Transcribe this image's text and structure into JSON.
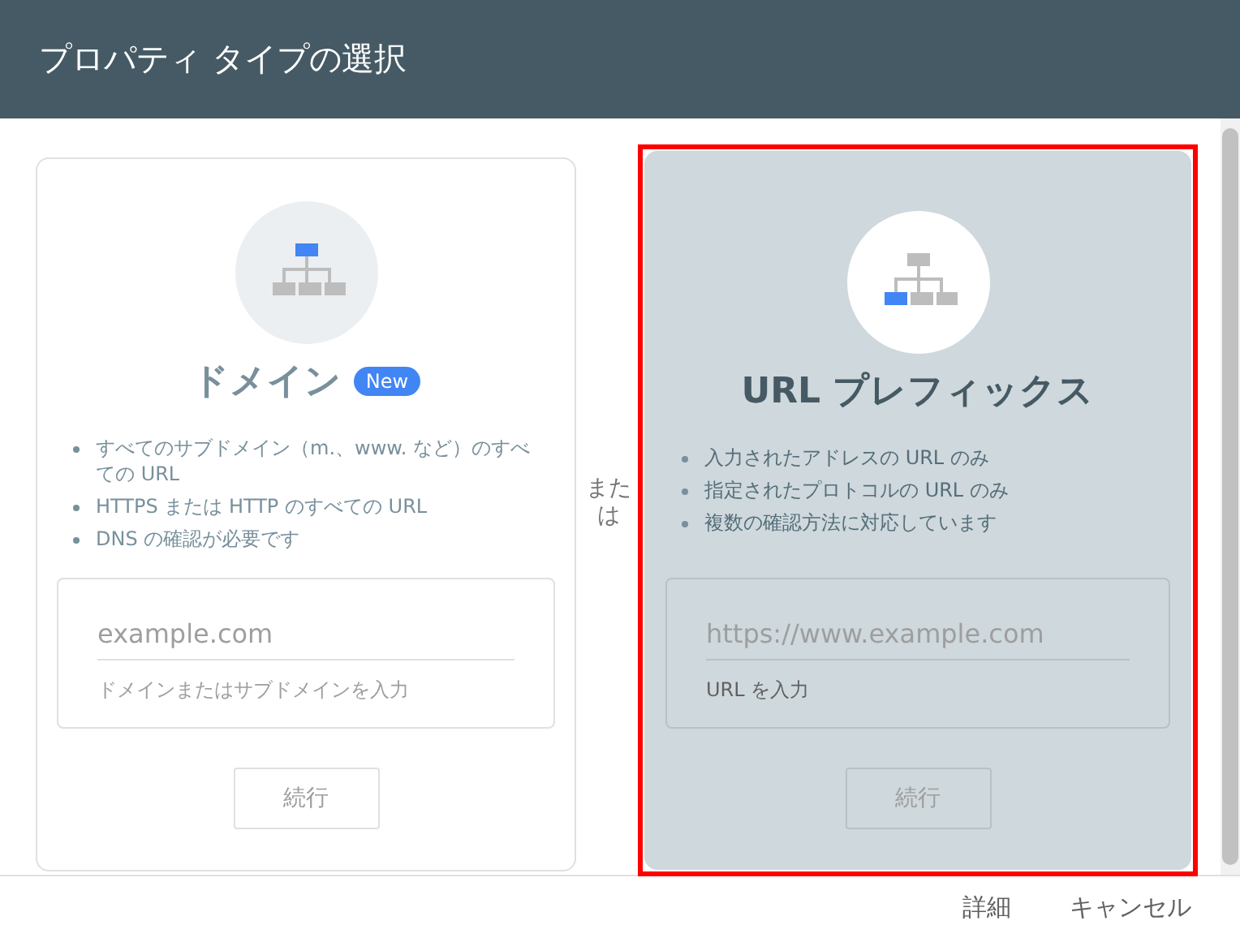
{
  "window": {
    "title": "プロパティ タイプの選択"
  },
  "separator": "または",
  "cards": [
    {
      "title": "ドメイン",
      "badge": "New",
      "selected": false,
      "bullets": [
        "すべてのサブドメイン（m.、www. など）のすべての URL",
        "HTTPS または HTTP のすべての URL",
        "DNS の確認が必要です"
      ],
      "field": {
        "placeholder": "example.com",
        "helper": "ドメインまたはサブドメインを入力"
      },
      "button": {
        "label": "続行",
        "disabled": true
      }
    },
    {
      "title": "URL プレフィックス",
      "selected": true,
      "bullets": [
        "入力されたアドレスの URL のみ",
        "指定されたプロトコルの URL のみ",
        "複数の確認方法に対応しています"
      ],
      "field": {
        "placeholder": "https://www.example.com",
        "helper": "URL を入力"
      },
      "button": {
        "label": "続行",
        "disabled": true
      }
    }
  ],
  "footer": {
    "buttons": [
      "詳細",
      "キャンセル"
    ]
  }
}
